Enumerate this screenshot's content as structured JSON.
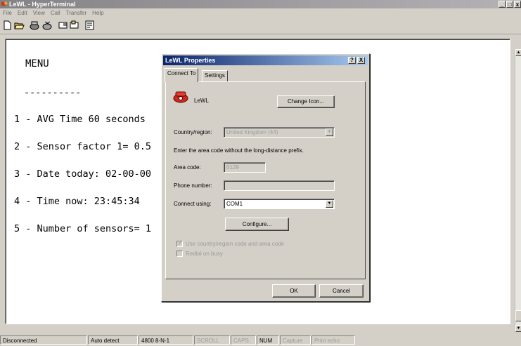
{
  "window": {
    "title": "LeWL - HyperTerminal",
    "controls": {
      "minimize": "_",
      "maximize": "□",
      "close": "x"
    }
  },
  "menu": [
    "File",
    "Edit",
    "View",
    "Call",
    "Transfer",
    "Help"
  ],
  "toolbar": {
    "icons": [
      "new-icon",
      "open-icon",
      "call-icon",
      "disconnect-icon",
      "send-icon",
      "receive-icon",
      "properties-icon"
    ]
  },
  "terminal": {
    "heading": "MENU",
    "lines": [
      "----------",
      "1 - AVG Time 60 seconds",
      "2 - Sensor factor 1= 0.5",
      "3 - Date today: 02-00-00",
      "4 - Time now: 23:45:34",
      "5 - Number of sensors= 1"
    ]
  },
  "dialog": {
    "title": "LeWL Properties",
    "help_btn": "?",
    "close_btn": "X",
    "tabs": [
      "Connect To",
      "Settings"
    ],
    "connection_name": "LeWL",
    "change_icon": "Change Icon...",
    "country_label": "Country/region:",
    "country_value": "United Kingdom (44)",
    "hint": "Enter the area code without the long-distance prefix.",
    "area_label": "Area code:",
    "area_value": "0129",
    "phone_label": "Phone number:",
    "phone_value": "",
    "connect_label": "Connect using:",
    "connect_value": "COM1",
    "configure": "Configure...",
    "use_country": "Use country/region code and area code",
    "redial": "Redial on busy",
    "ok": "OK",
    "cancel": "Cancel"
  },
  "status": {
    "connection": "Disconnected",
    "detect": "Auto detect",
    "settings": "4800 8-N-1",
    "scroll": "SCROLL",
    "caps": "CAPS",
    "num": "NUM",
    "capture": "Capture",
    "print_echo": "Print echo"
  }
}
